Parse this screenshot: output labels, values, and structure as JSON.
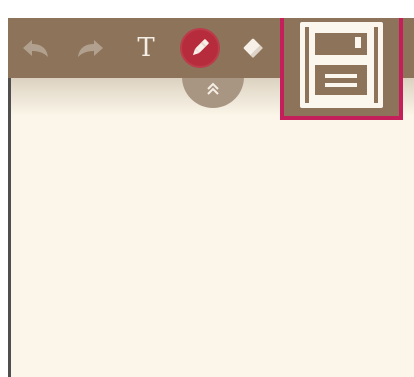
{
  "toolbar": {
    "undo_icon": "undo-arrow-icon",
    "redo_icon": "redo-arrow-icon",
    "text_tool": {
      "label": "T",
      "icon": "text-icon"
    },
    "pen_tool": {
      "icon": "pen-icon",
      "active": true,
      "accent_color": "#b72c3d"
    },
    "eraser_tool": {
      "icon": "eraser-icon"
    },
    "save_tool": {
      "icon": "floppy-disk-icon",
      "highlight_color": "#c51f5b"
    },
    "collapse_control": {
      "icon": "double-chevron-up-icon"
    }
  },
  "colors": {
    "toolbar": "#8c7359",
    "canvas": "#fbf6e9",
    "frame_border": "#4f4f4f",
    "icon_light": "#f4eee5"
  }
}
